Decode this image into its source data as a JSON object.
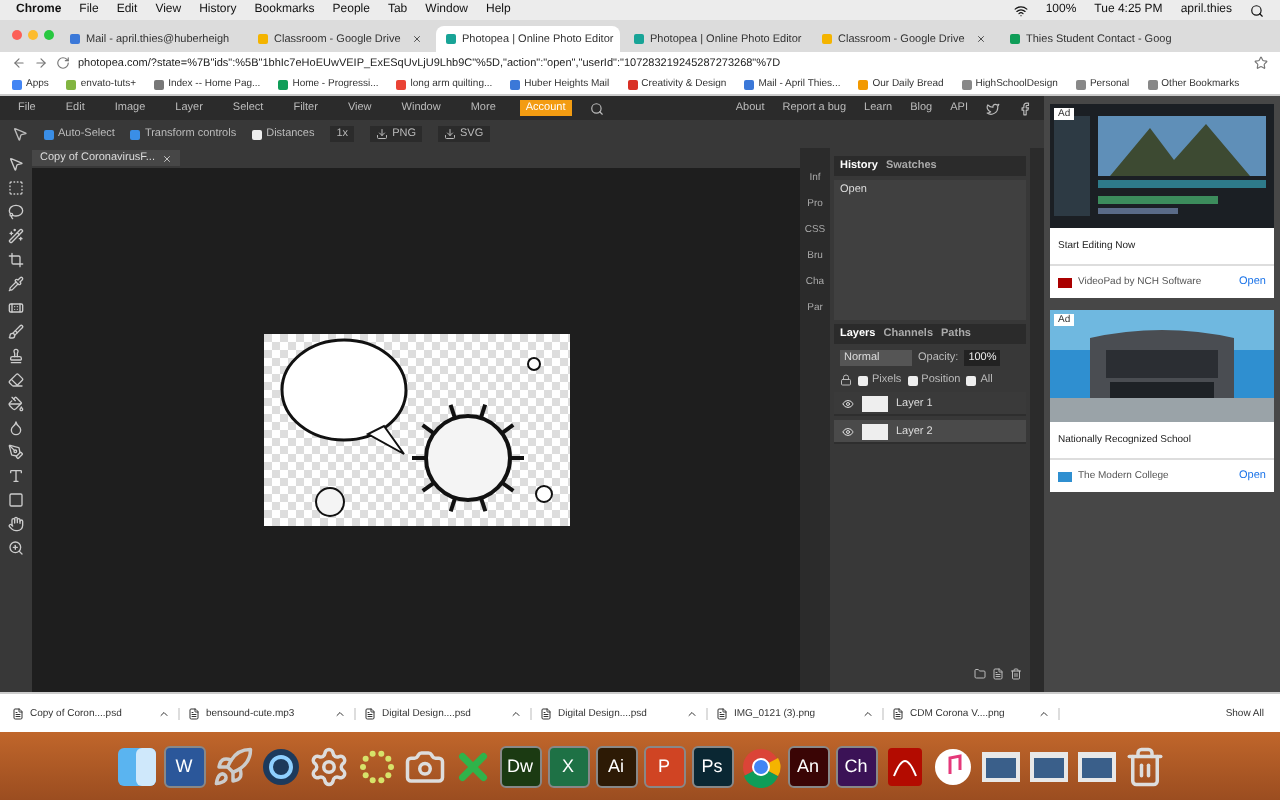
{
  "mac_menu": {
    "app": "Chrome",
    "items": [
      "File",
      "Edit",
      "View",
      "History",
      "Bookmarks",
      "People",
      "Tab",
      "Window",
      "Help"
    ],
    "battery": "100%",
    "clock": "Tue 4:25 PM",
    "user": "april.thies"
  },
  "tabs": [
    {
      "title": "Mail - april.thies@huberheigh",
      "selected": false,
      "color": "#3b78d8"
    },
    {
      "title": "Classroom - Google Drive",
      "selected": false,
      "color": "#f4b400"
    },
    {
      "title": "Photopea | Online Photo Editor",
      "selected": true,
      "color": "#18a497"
    },
    {
      "title": "Photopea | Online Photo Editor",
      "selected": false,
      "color": "#18a497"
    },
    {
      "title": "Classroom - Google Drive",
      "selected": false,
      "color": "#f4b400"
    },
    {
      "title": "Thies Student Contact - Goog",
      "selected": false,
      "color": "#0f9d58"
    }
  ],
  "address": {
    "url": "photopea.com/?state=%7B\"ids\":%5B\"1bhIc7eHoEUwVEIP_ExESqUvLjU9Lhb9C\"%5D,\"action\":\"open\",\"userId\":\"107283219245287273268\"%7D"
  },
  "bookmarks": [
    {
      "label": "Apps",
      "color": "#4285f4"
    },
    {
      "label": "envato-tuts+",
      "color": "#82b541"
    },
    {
      "label": "Index -- Home Pag...",
      "color": "#777777"
    },
    {
      "label": "Home - Progressi...",
      "color": "#0f9d58"
    },
    {
      "label": "long arm quilting...",
      "color": "#ea4335"
    },
    {
      "label": "Huber Heights Mail",
      "color": "#3b78d8"
    },
    {
      "label": "Creativity & Design",
      "color": "#d93025"
    },
    {
      "label": "Mail - April Thies...",
      "color": "#3b78d8"
    },
    {
      "label": "Our Daily Bread",
      "color": "#f29900"
    },
    {
      "label": "HighSchoolDesign",
      "color": "#888888"
    },
    {
      "label": "Personal",
      "color": "#888888"
    },
    {
      "label": "Other Bookmarks",
      "color": "#888888"
    }
  ],
  "editor": {
    "menu": [
      {
        "label": "File",
        "selected": false
      },
      {
        "label": "Edit",
        "selected": false
      },
      {
        "label": "Image",
        "selected": false
      },
      {
        "label": "Layer",
        "selected": false
      },
      {
        "label": "Select",
        "selected": false
      },
      {
        "label": "Filter",
        "selected": false
      },
      {
        "label": "View",
        "selected": false
      },
      {
        "label": "Window",
        "selected": false
      },
      {
        "label": "More",
        "selected": false
      },
      {
        "label": "Account",
        "selected": true
      }
    ],
    "links": [
      "About",
      "Report a bug",
      "Learn",
      "Blog",
      "API"
    ],
    "options": [
      {
        "label": "Auto-Select",
        "checked": true
      },
      {
        "label": "Transform controls",
        "checked": true
      },
      {
        "label": "Distances",
        "checked": false
      }
    ],
    "zoom": "1x",
    "exports": [
      "PNG",
      "SVG"
    ],
    "document_tab": "Copy of CoronavirusF...",
    "side_tabs": [
      "Inf",
      "Pro",
      "CSS",
      "Bru",
      "Cha",
      "Par"
    ],
    "history": {
      "tabs": [
        {
          "label": "History",
          "selected": true
        },
        {
          "label": "Swatches",
          "selected": false
        }
      ],
      "entries": [
        "Open"
      ]
    },
    "layers": {
      "tabs": [
        {
          "label": "Layers",
          "selected": true
        },
        {
          "label": "Channels",
          "selected": false
        },
        {
          "label": "Paths",
          "selected": false
        }
      ],
      "blend": "Normal",
      "opacity_label": "Opacity:",
      "opacity": "100%",
      "locks": [
        {
          "label": "Pixels",
          "checked": false
        },
        {
          "label": "Position",
          "checked": false
        },
        {
          "label": "All",
          "checked": false
        }
      ],
      "items": [
        {
          "name": "Layer 1",
          "selected": false
        },
        {
          "name": "Layer 2",
          "selected": true
        }
      ]
    }
  },
  "ads": [
    {
      "badge": "Ad",
      "headline": "Start Editing Now",
      "advertiser": "VideoPad by NCH Software",
      "action": "Open"
    },
    {
      "badge": "Ad",
      "headline": "Nationally Recognized School",
      "advertiser": "The Modern College",
      "action": "Open"
    }
  ],
  "downloads": {
    "files": [
      "Copy of Coron....psd",
      "bensound-cute.mp3",
      "Digital Design....psd",
      "Digital Design....psd",
      "IMG_0121 (3).png",
      "CDM Corona V....png"
    ],
    "show_all": "Show All"
  },
  "dock": [
    {
      "kind": "finder"
    },
    {
      "kind": "letter",
      "label": "W",
      "color": "#2b579a"
    },
    {
      "kind": "rocket"
    },
    {
      "kind": "quicktime"
    },
    {
      "kind": "gear"
    },
    {
      "kind": "dots"
    },
    {
      "kind": "camera"
    },
    {
      "kind": "cross"
    },
    {
      "kind": "letter",
      "label": "Dw",
      "color": "#1b3a12"
    },
    {
      "kind": "letter",
      "label": "X",
      "color": "#1e7145"
    },
    {
      "kind": "letter",
      "label": "Ai",
      "color": "#2d1a05"
    },
    {
      "kind": "letter",
      "label": "P",
      "color": "#d04423"
    },
    {
      "kind": "letter",
      "label": "Ps",
      "color": "#0a2733"
    },
    {
      "kind": "chrome"
    },
    {
      "kind": "letter",
      "label": "An",
      "color": "#3a0505"
    },
    {
      "kind": "letter",
      "label": "Ch",
      "color": "#3b1256"
    },
    {
      "kind": "acrobat"
    },
    {
      "kind": "music"
    },
    {
      "kind": "window"
    },
    {
      "kind": "window"
    },
    {
      "kind": "window"
    },
    {
      "kind": "trash"
    }
  ]
}
